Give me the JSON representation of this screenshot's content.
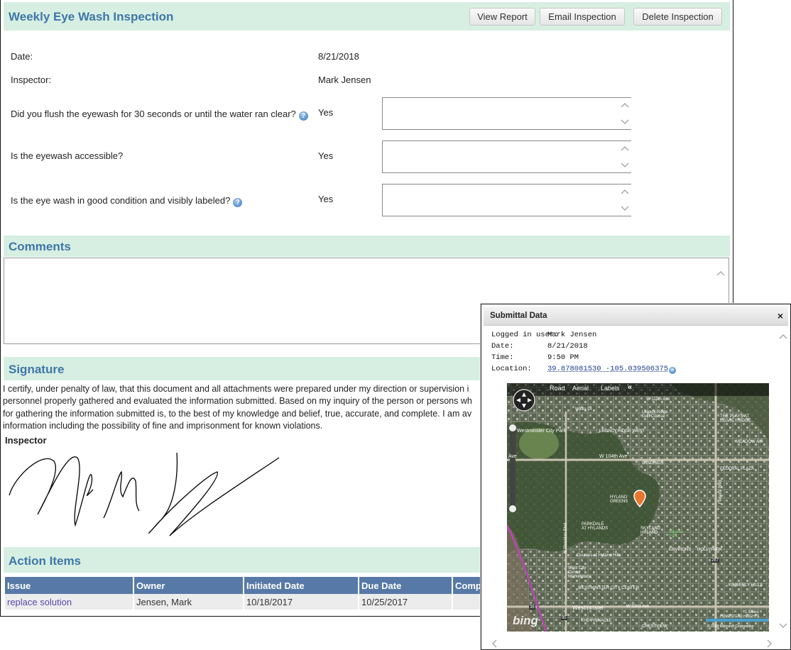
{
  "form": {
    "title": "Weekly Eye Wash Inspection",
    "buttons": {
      "view_report": "View Report",
      "email": "Email Inspection",
      "delete": "Delete Inspection"
    },
    "date_label": "Date:",
    "date_value": "8/21/2018",
    "inspector_label": "Inspector:",
    "inspector_value": "Mark Jensen",
    "questions": [
      {
        "text": "Did you flush the eyewash for 30 seconds or until the water ran clear?",
        "answer": "Yes",
        "help": true
      },
      {
        "text": "Is the eyewash accessible?",
        "answer": "Yes",
        "help": false
      },
      {
        "text": "Is the eye wash in good condition and visibly labeled?",
        "answer": "Yes",
        "help": true
      }
    ]
  },
  "comments": {
    "title": "Comments",
    "value": ""
  },
  "signature": {
    "title": "Signature",
    "cert_lines": [
      "I certify, under penalty of law, that this document and all attachments were prepared under my direction or supervision i",
      "personnel properly gathered and evaluated the information submitted. Based on my inquiry of the person or persons wh",
      "for gathering the information submitted is, to the best of my knowledge and belief, true, accurate, and complete. I am av",
      "information including the possibility of fine and imprisonment for known violations."
    ],
    "inspector_label": "Inspector"
  },
  "action_items": {
    "title": "Action Items",
    "columns": [
      "Issue",
      "Owner",
      "Initiated Date",
      "Due Date",
      "Compl"
    ],
    "rows": [
      {
        "issue": "replace solution",
        "owner": "Jensen, Mark",
        "initiated": "10/18/2017",
        "due": "10/25/2017",
        "completed": ""
      }
    ]
  },
  "popup": {
    "title": "Submittal Data",
    "close": "×",
    "logged_label": "Logged in user:",
    "logged_value": "Mark Jensen",
    "date_label": "Date:",
    "date_value": "8/21/2018",
    "time_label": "Time:",
    "time_value": "9:50 PM",
    "location_label": "Location:",
    "location_value": "39.878081530 -105.039506375",
    "map": {
      "toolbar": [
        "Road",
        "Aerial",
        "Labels"
      ],
      "collapse": "«",
      "brand": "bing",
      "copyright": "© 2018 Microsoft Corporation",
      "scale": "1 Miles",
      "labels": [
        "Westminster City Park",
        "Legacy Ridge Golf Course",
        "THE PLAYS AT LEGACYRIDGE",
        "LEGACY RIDGE WEST",
        "W 104th Ave",
        "WINDINGS",
        "FEDERAL PLAZA",
        "HYLAND GREENS",
        "PARKDALE AT HYLANDS",
        "SKYLAND HYLAND",
        "Squires Park",
        "ENVIRONS",
        "HOLLYPARK",
        "Courses at Hyland Hills",
        "West City Center Marketplace",
        "WESTMINSTER CITY CENTER",
        "Westminster",
        "W 92nd Ave",
        "Federal Blvd",
        "N Sheridan Blvd",
        "Willits Dr",
        "W 112th Ave",
        "MEADOW AIR",
        "Ave",
        "287",
        "36",
        "95",
        "THE PINNACLE",
        "CRESTVIEW",
        "KIMBERLY HILLS",
        "HOMESTEAD HEIGHTS"
      ]
    }
  },
  "colors": {
    "section_bg": "#d6efe2",
    "section_title": "#3f76a8",
    "table_header": "#5779a7",
    "link": "#5a4ab0"
  }
}
